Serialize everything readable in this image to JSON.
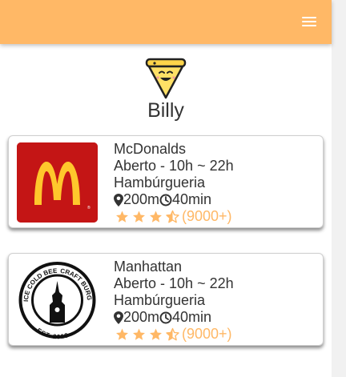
{
  "app": {
    "brand": "Billy",
    "accent_color": "#ffb866",
    "menu_icon": "hamburger-menu-icon"
  },
  "restaurants": [
    {
      "name": "McDonalds",
      "hours": "Aberto - 10h ~ 22h",
      "category": "Hambúrgueria",
      "distance": "200m",
      "time": "40min",
      "rating": 3.5,
      "reviews": "(9000+)",
      "logo": "mcdonalds-logo",
      "logo_text": "M"
    },
    {
      "name": "Manhattan",
      "hours": "Aberto - 10h ~ 22h",
      "category": "Hambúrgueria",
      "distance": "200m",
      "time": "40min",
      "rating": 3.5,
      "reviews": "(9000+)",
      "logo": "manhattan-logo",
      "logo_top_left": "ICE COLD BEER",
      "logo_top_right": "CRAFT BURGERS",
      "logo_bottom": "EST. 2018"
    }
  ]
}
